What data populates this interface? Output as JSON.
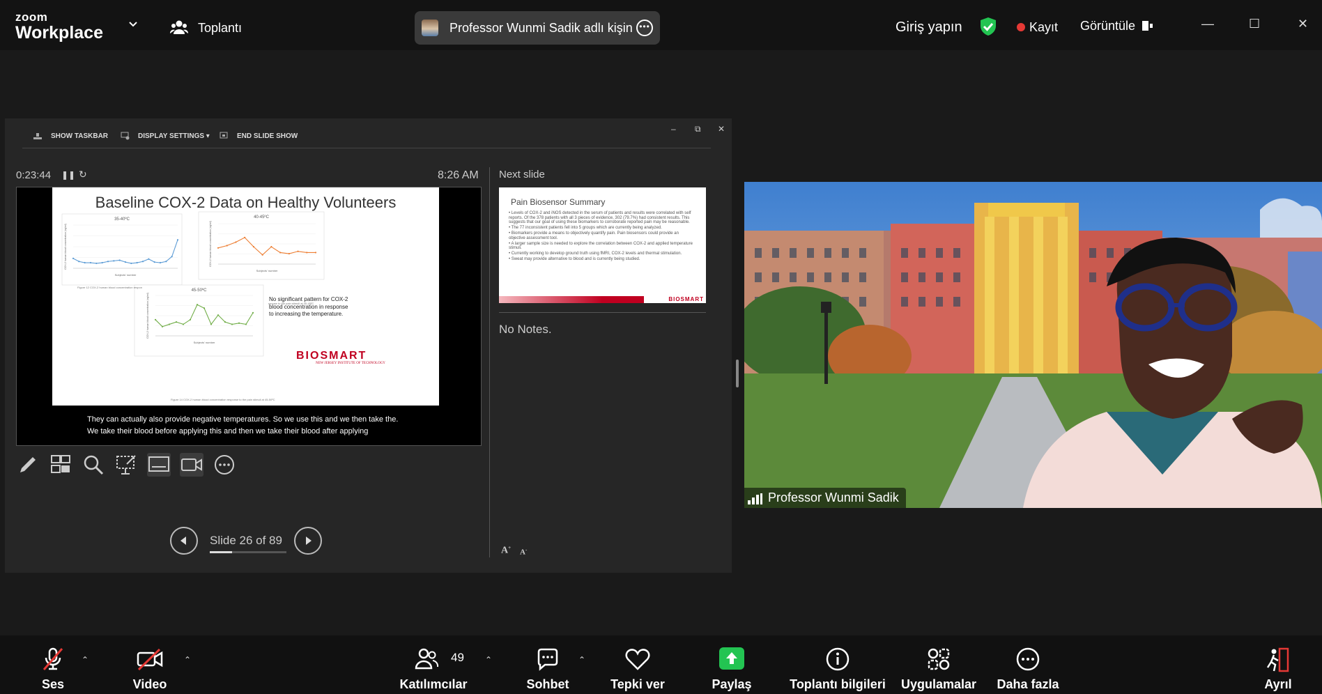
{
  "topbar": {
    "brand_top": "zoom",
    "brand_bottom": "Workplace",
    "meeting_label": "Toplantı",
    "speaker_pill": "Professor Wunmi Sadik adlı kişin",
    "signin": "Giriş yapın",
    "record_label": "Kayıt",
    "view_label": "Görüntüle",
    "win_min": "—",
    "win_max": "☐",
    "win_close": "✕",
    "colors": {
      "shield": "#23c452",
      "record": "#e53935"
    }
  },
  "presenter": {
    "toolbar": {
      "show_taskbar": "SHOW TASKBAR",
      "display_settings": "DISPLAY SETTINGS ▾",
      "end_slide_show": "END SLIDE SHOW"
    },
    "window_controls": {
      "min": "–",
      "restore": "⧉",
      "close": "✕"
    },
    "timer": "0:23:44",
    "clock": "8:26 AM",
    "slide": {
      "title": "Baseline COX-2 Data on Healthy Volunteers",
      "chart1_title": "35-40ºC",
      "chart2_title": "40-45ºC",
      "chart3_title": "45-50ºC",
      "xlabel": "Subjects' number",
      "ylabel": "COX-2 human blood concentration (ng/ml)",
      "fig1_caption": "Figure 12 COX-2 human blood concentration respon",
      "fig2_caption": "sponse to the pain stimuli at 40-45ºC",
      "fig3_caption": "Figure 14 COX-2 human blood concentration response to the pain stimuli at 45-50ºC",
      "note": "No significant pattern for COX-2 blood concentration in response to increasing the temperature.",
      "logo": "BioSmart",
      "logo_sub": "New Jersey Institute of Technology"
    },
    "caption_line1": "They can actually also provide negative temperatures. So we use this and we then take the.",
    "caption_line2": "We take their blood before applying this and then we take their blood after applying",
    "slide_counter": "Slide 26 of 89",
    "slide_progress": 0.29,
    "next_slide_label": "Next slide",
    "next_slide": {
      "title": "Pain Biosensor Summary",
      "bullets": [
        "Levels of COX-2 and iNOS detected in the serum of patients and results were correlated with self reports. Of the 378 patients with all 3 pieces of evidence, 302 (79.7%) had consistent results. This suggests that our goal of using these biomarkers to corroborate reported pain may be reasonable.",
        "The 77 inconsistent patients fell into 5 groups which are currently being analyzed.",
        "Biomarkers provide a means to objectively quantify pain. Pain biosensors could provide an objective assessment tool.",
        "A larger sample size is needed to explore the correlation between COX-2 and applied temperature stimuli.",
        "Currently working to develop ground truth using fMRI, COX-2 levels and thermal stimulation.",
        "Sweat may provide alternative to blood and is currently being studied."
      ],
      "logo": "BioSmart"
    },
    "notes": "No Notes."
  },
  "video": {
    "name": "Professor Wunmi Sadik"
  },
  "bottombar": {
    "audio": "Ses",
    "video": "Video",
    "participants": "Katılımcılar",
    "participants_count": "49",
    "chat": "Sohbet",
    "react": "Tepki ver",
    "share": "Paylaş",
    "meeting_info": "Toplantı bilgileri",
    "apps": "Uygulamalar",
    "more": "Daha fazla",
    "leave": "Ayrıl",
    "colors": {
      "share": "#23c452",
      "mute": "#e53935",
      "leave": "#e53935"
    }
  },
  "chart_data": [
    {
      "type": "line",
      "title": "35-40ºC",
      "xlabel": "Subjects' number",
      "ylabel": "COX-2 human blood concentration (ng/ml)",
      "ylim": [
        0,
        7
      ],
      "values": [
        1.6,
        1.1,
        0.9,
        0.9,
        0.8,
        0.9,
        1.1,
        1.2,
        1.3,
        1.0,
        0.8,
        0.9,
        1.1,
        1.5,
        1.0,
        0.9,
        1.1,
        1.9,
        4.6
      ]
    },
    {
      "type": "line",
      "title": "40-45ºC",
      "xlabel": "Subjects' number",
      "ylabel": "COX-2 human blood concentration (ng/ml)",
      "ylim": [
        0,
        3.5
      ],
      "values": [
        1.4,
        1.6,
        1.9,
        2.3,
        1.5,
        0.8,
        1.5,
        1.0,
        0.9,
        1.1,
        1.0,
        1.0
      ]
    },
    {
      "type": "line",
      "title": "45-50ºC",
      "xlabel": "Subjects' number",
      "ylabel": "COX-2 human blood concentration (ng/ml)",
      "ylim": [
        0,
        3.5
      ],
      "values": [
        1.4,
        0.8,
        1.0,
        1.2,
        1.0,
        1.4,
        2.7,
        2.4,
        1.0,
        1.8,
        1.2,
        1.0,
        1.1,
        1.0,
        2.0
      ]
    }
  ]
}
